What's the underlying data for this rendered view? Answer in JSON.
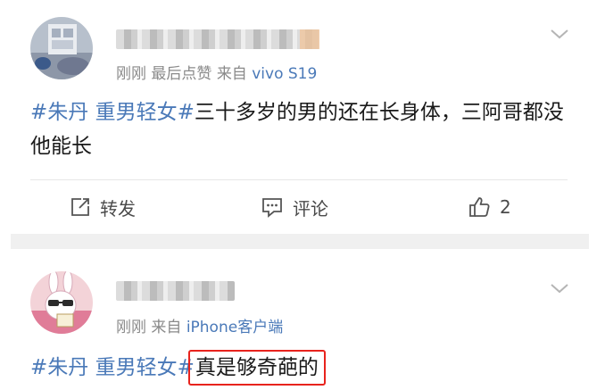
{
  "posts": [
    {
      "meta": {
        "time": "刚刚",
        "activity": "最后点赞",
        "source_prefix": "来自",
        "source_device": "vivo S19"
      },
      "content": {
        "hashtag": "#朱丹 重男轻女#",
        "text": "三十多岁的男的还在长身体，三阿哥都没他能长"
      },
      "actions": {
        "repost_label": "转发",
        "comment_label": "评论",
        "like_count": "2"
      },
      "icons": [
        "avatar-photo",
        "chevron-down-icon",
        "repost-icon",
        "comment-icon",
        "thumbs-up-icon"
      ]
    },
    {
      "meta": {
        "time": "刚刚",
        "source_prefix": "来自",
        "source_device": "iPhone客户端"
      },
      "content": {
        "hashtag": "#朱丹 重男轻女#",
        "text": "真是够奇葩的"
      },
      "icons": [
        "avatar-bunny-cartoon",
        "chevron-down-icon"
      ]
    }
  ],
  "colors": {
    "link_blue": "#4a79b8",
    "highlight_red": "#e8231d",
    "meta_gray": "#8a8a8a",
    "separator_gray": "#f0f0f0"
  }
}
